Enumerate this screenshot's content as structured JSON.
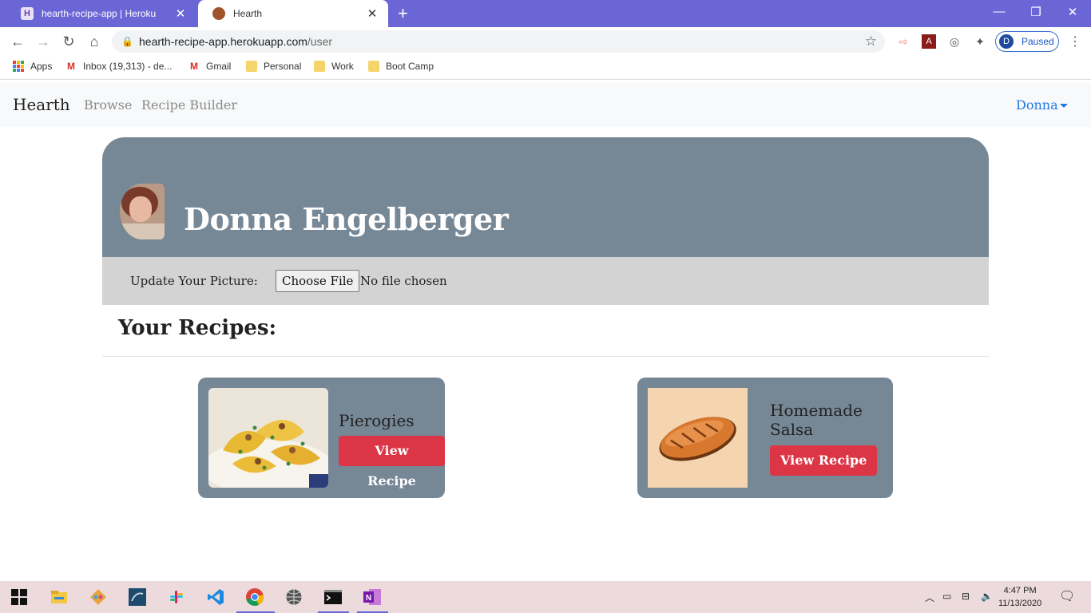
{
  "browser": {
    "tabs": [
      {
        "title": "hearth-recipe-app | Heroku"
      },
      {
        "title": "Hearth"
      }
    ],
    "url_host": "hearth-recipe-app.herokuapp.com",
    "url_path": "/user",
    "profile_initial": "D",
    "profile_status": "Paused",
    "bookmarks": [
      "Apps",
      "Inbox (19,313) - de...",
      "Gmail",
      "Personal",
      "Work",
      "Boot Camp"
    ]
  },
  "site": {
    "brand": "Hearth",
    "nav": [
      "Browse",
      "Recipe Builder"
    ],
    "user_menu": "Donna"
  },
  "profile": {
    "name": "Donna Engelberger",
    "upload_label": "Update Your Picture:",
    "choose_file": "Choose File",
    "no_file": "No file chosen"
  },
  "recipes": {
    "heading": "Your Recipes:",
    "items": [
      {
        "name": "Pierogies",
        "button": "View Recipe",
        "image": "pierogies-photo"
      },
      {
        "name": "Homemade Salsa",
        "button": "View Recipe",
        "image": "bread-loaf-illustration"
      }
    ]
  },
  "taskbar": {
    "time": "4:47 PM",
    "date": "11/13/2020",
    "apps": [
      "windows-start",
      "file-explorer",
      "git-client",
      "mysql-workbench",
      "slack",
      "vscode",
      "chrome",
      "network-app",
      "terminal",
      "onenote"
    ]
  },
  "colors": {
    "tabbar": "#6b66d6",
    "hero": "#768796",
    "button": "#dc3545",
    "link": "#1f7ae0"
  }
}
